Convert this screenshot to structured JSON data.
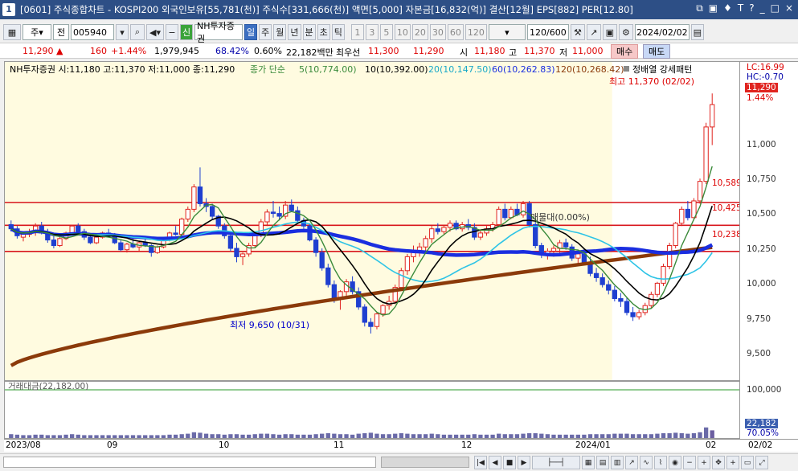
{
  "titlebar": {
    "window_number": "1",
    "title": "[0601] 주식종합차트 - KOSPI200 외국인보유[55,781(천)] 주식수[331,666(천)] 액면[5,000] 자본금[16,832(억)] 결산[12월] EPS[882] PER[12.80]",
    "icons": [
      "⧉",
      "▣",
      "♦",
      "T",
      "?",
      "_",
      "□",
      "×"
    ]
  },
  "toolbar": {
    "market_type": "주",
    "period_select": "전",
    "code": "005940",
    "credit_badge": "신",
    "stock_name": "NH투자증권",
    "tabs": [
      "일",
      "주",
      "월",
      "년",
      "분",
      "초",
      "틱"
    ],
    "selected_tab": "일",
    "intervals": [
      "1",
      "3",
      "5",
      "10",
      "20",
      "30",
      "60",
      "120"
    ],
    "count": "120",
    "count_total": "/600",
    "date": "2024/02/02"
  },
  "quote": {
    "price": "11,290",
    "change_arrow": "▲",
    "change": "160",
    "change_pct": "+1.44%",
    "volume": "1,979,945",
    "volume_ratio": "68.42%",
    "turnover": "0.60%",
    "amount": "22,182백만",
    "best_ask_label": "최우선",
    "best_ask": "11,300",
    "best_bid": "11,290",
    "open_label": "시",
    "open": "11,180",
    "high_label": "고",
    "high": "11,370",
    "low_label": "저",
    "low": "11,000",
    "buy_label": "매수",
    "sell_label": "매도"
  },
  "legend": {
    "stock": "NH투자증권 시:11,180 고:11,370 저:11,000 종:11,290",
    "ma_type": "종가 단순",
    "ma5": "5(10,774.00)",
    "ma10": "10(10,392.00)",
    "ma20": "20(10,147.50)",
    "ma60": "60(10,262.83)",
    "ma120": "120(10,268.42)",
    "pattern": "정배열 강세패턴",
    "ma5_color": "#3a8a3a",
    "ma10_color": "#000000",
    "ma20_color": "#2ec4e6",
    "ma60_color": "#1a2ee0",
    "ma120_color": "#8b3a0a"
  },
  "annotations": {
    "high": "최고 11,370 (02/02)",
    "low": "최저 9,650 (10/31)",
    "mid": "매물대(0.00%)",
    "h1": "10,589",
    "h2": "10,425",
    "h3": "10,238",
    "lc": "LC:16.99",
    "hc": "HC:-0.70"
  },
  "price_axis": {
    "labels": [
      "11,000",
      "10,750",
      "10,500",
      "10,250",
      "10,000",
      "9,750",
      "9,500"
    ],
    "current": "11,290",
    "current_pct": "1.44%"
  },
  "volume": {
    "legend": "거래대금(22,182.00)",
    "axis_label": "100,000",
    "current": "22,182",
    "current_pct": "70.05%"
  },
  "x_axis": {
    "labels": [
      "2023/08",
      "09",
      "10",
      "11",
      "12",
      "2024/01",
      "02"
    ],
    "right_label": "02/02"
  },
  "chart_data": {
    "type": "candlestick",
    "ylim": [
      9350,
      11550
    ],
    "highlight_end": 0.825,
    "hlines": [
      10589,
      10425,
      10238
    ],
    "candles": [
      [
        10430,
        10460,
        10380,
        10400
      ],
      [
        10400,
        10420,
        10330,
        10350
      ],
      [
        10340,
        10380,
        10310,
        10360
      ],
      [
        10360,
        10400,
        10340,
        10380
      ],
      [
        10380,
        10440,
        10350,
        10420
      ],
      [
        10420,
        10450,
        10360,
        10370
      ],
      [
        10370,
        10400,
        10300,
        10320
      ],
      [
        10320,
        10350,
        10260,
        10280
      ],
      [
        10280,
        10340,
        10270,
        10330
      ],
      [
        10330,
        10380,
        10320,
        10370
      ],
      [
        10370,
        10430,
        10360,
        10420
      ],
      [
        10420,
        10440,
        10370,
        10380
      ],
      [
        10380,
        10400,
        10320,
        10340
      ],
      [
        10340,
        10360,
        10290,
        10300
      ],
      [
        10300,
        10350,
        10290,
        10340
      ],
      [
        10340,
        10380,
        10330,
        10370
      ],
      [
        10370,
        10400,
        10340,
        10350
      ],
      [
        10350,
        10370,
        10290,
        10300
      ],
      [
        10300,
        10320,
        10240,
        10250
      ],
      [
        10250,
        10300,
        10230,
        10290
      ],
      [
        10290,
        10330,
        10260,
        10270
      ],
      [
        10270,
        10310,
        10240,
        10300
      ],
      [
        10300,
        10330,
        10270,
        10280
      ],
      [
        10280,
        10290,
        10200,
        10230
      ],
      [
        10230,
        10280,
        10220,
        10270
      ],
      [
        10270,
        10330,
        10260,
        10320
      ],
      [
        10320,
        10380,
        10310,
        10370
      ],
      [
        10370,
        10420,
        10350,
        10360
      ],
      [
        10360,
        10480,
        10350,
        10470
      ],
      [
        10470,
        10560,
        10450,
        10540
      ],
      [
        10540,
        10720,
        10520,
        10700
      ],
      [
        10700,
        10840,
        10560,
        10580
      ],
      [
        10580,
        10620,
        10520,
        10560
      ],
      [
        10560,
        10580,
        10470,
        10490
      ],
      [
        10490,
        10500,
        10400,
        10420
      ],
      [
        10420,
        10440,
        10330,
        10350
      ],
      [
        10350,
        10360,
        10240,
        10260
      ],
      [
        10260,
        10300,
        10160,
        10200
      ],
      [
        10200,
        10230,
        10140,
        10220
      ],
      [
        10220,
        10300,
        10200,
        10280
      ],
      [
        10280,
        10380,
        10260,
        10360
      ],
      [
        10360,
        10470,
        10340,
        10450
      ],
      [
        10450,
        10540,
        10420,
        10520
      ],
      [
        10520,
        10600,
        10480,
        10510
      ],
      [
        10510,
        10560,
        10460,
        10490
      ],
      [
        10490,
        10600,
        10470,
        10570
      ],
      [
        10570,
        10610,
        10520,
        10530
      ],
      [
        10530,
        10560,
        10440,
        10460
      ],
      [
        10460,
        10480,
        10400,
        10420
      ],
      [
        10420,
        10440,
        10310,
        10320
      ],
      [
        10320,
        10340,
        10200,
        10230
      ],
      [
        10230,
        10260,
        10100,
        10120
      ],
      [
        10120,
        10150,
        9980,
        10000
      ],
      [
        10000,
        10030,
        9870,
        9900
      ],
      [
        9900,
        9960,
        9820,
        9950
      ],
      [
        9950,
        10040,
        9920,
        10020
      ],
      [
        10020,
        10060,
        9930,
        9950
      ],
      [
        9950,
        9980,
        9820,
        9840
      ],
      [
        9840,
        9860,
        9700,
        9730
      ],
      [
        9730,
        9760,
        9650,
        9700
      ],
      [
        9700,
        9800,
        9680,
        9790
      ],
      [
        9790,
        9860,
        9770,
        9850
      ],
      [
        9850,
        9920,
        9820,
        9880
      ],
      [
        9880,
        10000,
        9860,
        9980
      ],
      [
        9980,
        10120,
        9960,
        10100
      ],
      [
        10100,
        10220,
        10070,
        10200
      ],
      [
        10200,
        10280,
        10160,
        10240
      ],
      [
        10240,
        10300,
        10200,
        10270
      ],
      [
        10270,
        10350,
        10240,
        10330
      ],
      [
        10330,
        10420,
        10300,
        10400
      ],
      [
        10400,
        10440,
        10360,
        10380
      ],
      [
        10380,
        10430,
        10360,
        10410
      ],
      [
        10410,
        10460,
        10380,
        10440
      ],
      [
        10440,
        10460,
        10390,
        10400
      ],
      [
        10400,
        10450,
        10380,
        10430
      ],
      [
        10430,
        10470,
        10390,
        10410
      ],
      [
        10410,
        10440,
        10320,
        10340
      ],
      [
        10340,
        10390,
        10320,
        10370
      ],
      [
        10370,
        10420,
        10350,
        10400
      ],
      [
        10400,
        10450,
        10380,
        10430
      ],
      [
        10430,
        10560,
        10420,
        10540
      ],
      [
        10540,
        10580,
        10460,
        10480
      ],
      [
        10480,
        10560,
        10470,
        10540
      ],
      [
        10540,
        10580,
        10490,
        10500
      ],
      [
        10500,
        10600,
        10480,
        10580
      ],
      [
        10580,
        10600,
        10410,
        10430
      ],
      [
        10430,
        10450,
        10260,
        10280
      ],
      [
        10280,
        10300,
        10190,
        10220
      ],
      [
        10220,
        10260,
        10180,
        10240
      ],
      [
        10240,
        10280,
        10200,
        10260
      ],
      [
        10260,
        10320,
        10220,
        10300
      ],
      [
        10300,
        10330,
        10250,
        10270
      ],
      [
        10270,
        10290,
        10170,
        10190
      ],
      [
        10190,
        10240,
        10150,
        10220
      ],
      [
        10220,
        10260,
        10140,
        10160
      ],
      [
        10160,
        10200,
        10060,
        10080
      ],
      [
        10080,
        10120,
        10020,
        10050
      ],
      [
        10050,
        10080,
        9980,
        10000
      ],
      [
        10000,
        10030,
        9930,
        9960
      ],
      [
        9960,
        9990,
        9880,
        9900
      ],
      [
        9900,
        9940,
        9840,
        9880
      ],
      [
        9880,
        9910,
        9780,
        9800
      ],
      [
        9800,
        9840,
        9740,
        9770
      ],
      [
        9770,
        9820,
        9750,
        9800
      ],
      [
        9800,
        9870,
        9780,
        9850
      ],
      [
        9850,
        9950,
        9830,
        9930
      ],
      [
        9930,
        10020,
        9910,
        10010
      ],
      [
        10010,
        10150,
        9990,
        10130
      ],
      [
        10130,
        10300,
        10110,
        10280
      ],
      [
        10280,
        10450,
        10260,
        10440
      ],
      [
        10440,
        10560,
        10420,
        10540
      ],
      [
        10540,
        10600,
        10460,
        10480
      ],
      [
        10480,
        10620,
        10470,
        10600
      ],
      [
        10600,
        10760,
        10580,
        10740
      ],
      [
        10740,
        11160,
        10720,
        11130
      ],
      [
        11130,
        11370,
        11000,
        11290
      ]
    ],
    "volumes": [
      8,
      7,
      6,
      6,
      7,
      7,
      6,
      6,
      6,
      7,
      8,
      7,
      6,
      6,
      6,
      6,
      6,
      6,
      6,
      6,
      6,
      6,
      6,
      6,
      6,
      6,
      7,
      7,
      8,
      9,
      12,
      11,
      9,
      8,
      8,
      7,
      8,
      8,
      7,
      7,
      8,
      9,
      9,
      8,
      7,
      8,
      8,
      7,
      7,
      7,
      8,
      9,
      10,
      9,
      8,
      8,
      7,
      9,
      10,
      11,
      9,
      8,
      8,
      9,
      10,
      9,
      8,
      8,
      8,
      9,
      8,
      7,
      7,
      7,
      7,
      7,
      8,
      7,
      7,
      7,
      9,
      8,
      8,
      8,
      9,
      10,
      10,
      9,
      8,
      7,
      7,
      7,
      7,
      7,
      7,
      8,
      8,
      8,
      8,
      9,
      9,
      9,
      8,
      8,
      8,
      8,
      9,
      10,
      10,
      11,
      10,
      9,
      10,
      12,
      22,
      16
    ]
  }
}
